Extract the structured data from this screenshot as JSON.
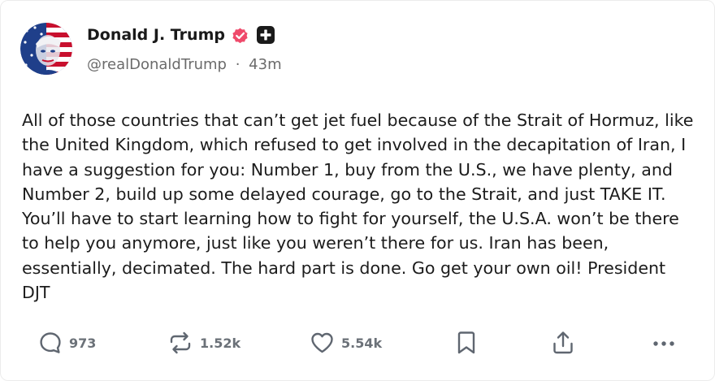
{
  "post": {
    "author_name": "Donald J. Trump",
    "handle": "@realDonaldTrump",
    "separator": "·",
    "time_ago": "43m",
    "body": "All of those countries that can’t get jet fuel because of the Strait of Hormuz, like the United Kingdom, which refused to get involved in the decapitation of Iran, I have a suggestion for you: Number 1, buy from the U.S., we have plenty, and Number 2, build up some delayed courage, go to the Strait, and just TAKE IT. You’ll have to start learning how to fight for yourself, the U.S.A. won’t be there to help you anymore, just like you weren’t there for us. Iran has been, essentially, decimated. The hard part is done. Go get your own oil! President DJT"
  },
  "actions": {
    "replies": "973",
    "reposts": "1.52k",
    "likes": "5.54k"
  },
  "icons": {
    "verified": "verified-badge-icon",
    "plus": "plus-badge-icon",
    "reply": "reply-icon",
    "repost": "repost-icon",
    "like": "heart-icon",
    "bookmark": "bookmark-icon",
    "share": "share-icon",
    "more": "more-icon"
  },
  "colors": {
    "verified_badge": "#ef4a6b",
    "action_icon": "#5f6670",
    "text": "#1a1a1a",
    "muted": "#6b6b6b"
  }
}
